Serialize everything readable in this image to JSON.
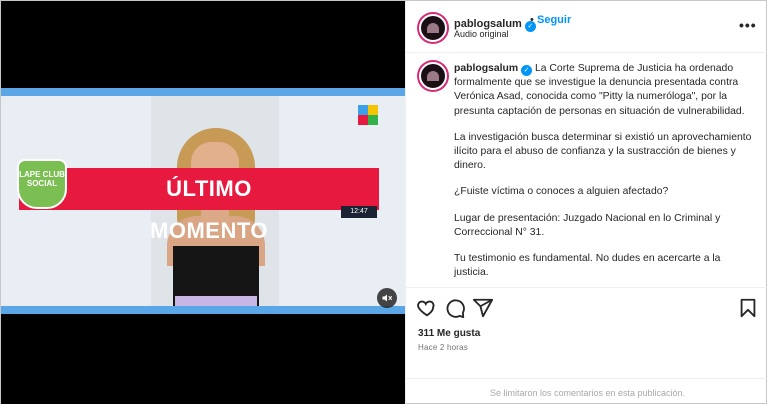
{
  "post": {
    "username": "pablogsalum",
    "separator": "•",
    "follow_label": "Seguir",
    "audio_label": "Audio original",
    "more_icon": "more-horizontal-icon",
    "verified_icon": "verified-badge-icon"
  },
  "video": {
    "banner_text": "ÚLTIMO MOMENTO",
    "badge_text": "LAPE CLUB SOCIAL",
    "time_chip": "12:47",
    "mute_icon": "speaker-muted-icon",
    "accent_colors": {
      "banner": "#e8193f",
      "frame_bars": "#5aa6e6",
      "badge": "#7bbf52"
    }
  },
  "caption": {
    "username": "pablogsalum",
    "paragraphs": [
      "La Corte Suprema de Justicia ha ordenado formalmente que se investigue la denuncia presentada contra Verónica Asad, conocida como \"Pitty la numeróloga\", por la presunta captación de personas en situación de vulnerabilidad.",
      "La investigación busca determinar si existió un aprovechamiento ilícito para el abuso de confianza y la sustracción de bienes y dinero.",
      "¿Fuiste víctima o conoces a alguien afectado?",
      "Lugar de presentación: Juzgado Nacional en lo Criminal y Correccional N° 31.",
      "Tu testimonio es fundamental. No dudes en acercarte a la justicia."
    ]
  },
  "actions": {
    "icons": [
      "heart-icon",
      "comment-icon",
      "share-icon",
      "bookmark-icon"
    ],
    "likes": "311 Me gusta",
    "time_ago": "Hace 2 horas",
    "comments_disabled": "Se limitaron los comentarios en esta publicación."
  }
}
